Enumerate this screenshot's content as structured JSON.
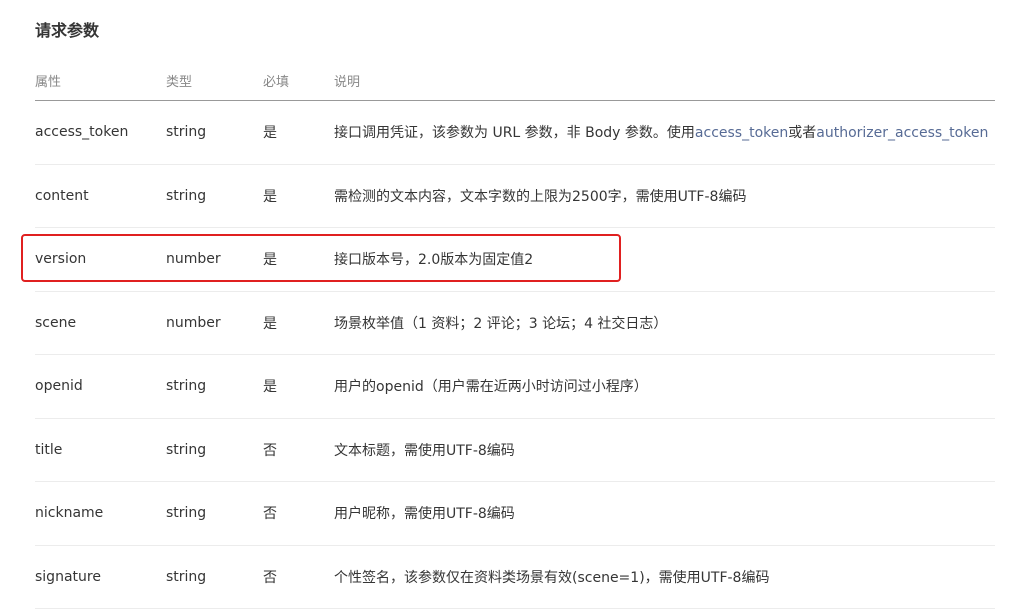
{
  "section_title": "请求参数",
  "headers": {
    "attr": "属性",
    "type": "类型",
    "required": "必填",
    "desc": "说明"
  },
  "rows": [
    {
      "attr": "access_token",
      "type": "string",
      "required": "是",
      "desc_prefix": "接口调用凭证，该参数为 URL 参数，非 Body 参数。使用",
      "link1": "access_token",
      "desc_mid": "或者",
      "link2": "authorizer_access_token"
    },
    {
      "attr": "content",
      "type": "string",
      "required": "是",
      "desc": "需检测的文本内容，文本字数的上限为2500字，需使用UTF-8编码"
    },
    {
      "attr": "version",
      "type": "number",
      "required": "是",
      "desc": "接口版本号，2.0版本为固定值2"
    },
    {
      "attr": "scene",
      "type": "number",
      "required": "是",
      "desc": "场景枚举值（1 资料；2 评论；3 论坛；4 社交日志）"
    },
    {
      "attr": "openid",
      "type": "string",
      "required": "是",
      "desc": "用户的openid（用户需在近两小时访问过小程序）"
    },
    {
      "attr": "title",
      "type": "string",
      "required": "否",
      "desc": "文本标题，需使用UTF-8编码"
    },
    {
      "attr": "nickname",
      "type": "string",
      "required": "否",
      "desc": "用户昵称，需使用UTF-8编码"
    },
    {
      "attr": "signature",
      "type": "string",
      "required": "否",
      "desc": "个性签名，该参数仅在资料类场景有效(scene=1)，需使用UTF-8编码"
    }
  ],
  "colors": {
    "link": "#576b95",
    "highlight": "#e02020"
  }
}
